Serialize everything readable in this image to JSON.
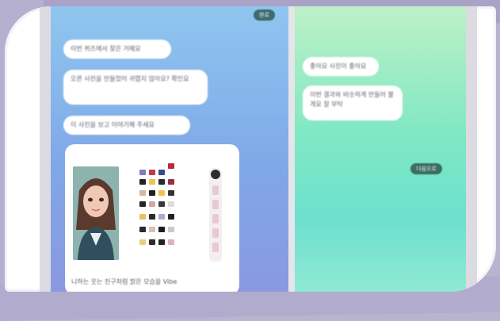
{
  "chat_left": {
    "top_badge": "완료",
    "messages": [
      "이번 퀴즈에서 찾은 거예요",
      "오른 사진을 만들었어 귀엽지 않아요? 확인요",
      "이 사진을 보고 이야기해 주세요"
    ],
    "photo_caption": "니하는 웃는 친구처럼 밝은 모습을 Vibe"
  },
  "chat_right": {
    "messages": [
      "좋아요 사진이 좋아요",
      "이번 결과와 비슷하게 만들어 볼게요 잘 부탁"
    ],
    "badge": "다음으로"
  },
  "colors": {
    "left_panel_top": "#8fc6ef",
    "right_panel_top": "#bdf0c7",
    "badge": "#3f6a6e",
    "frame": "#b8b3cf"
  }
}
